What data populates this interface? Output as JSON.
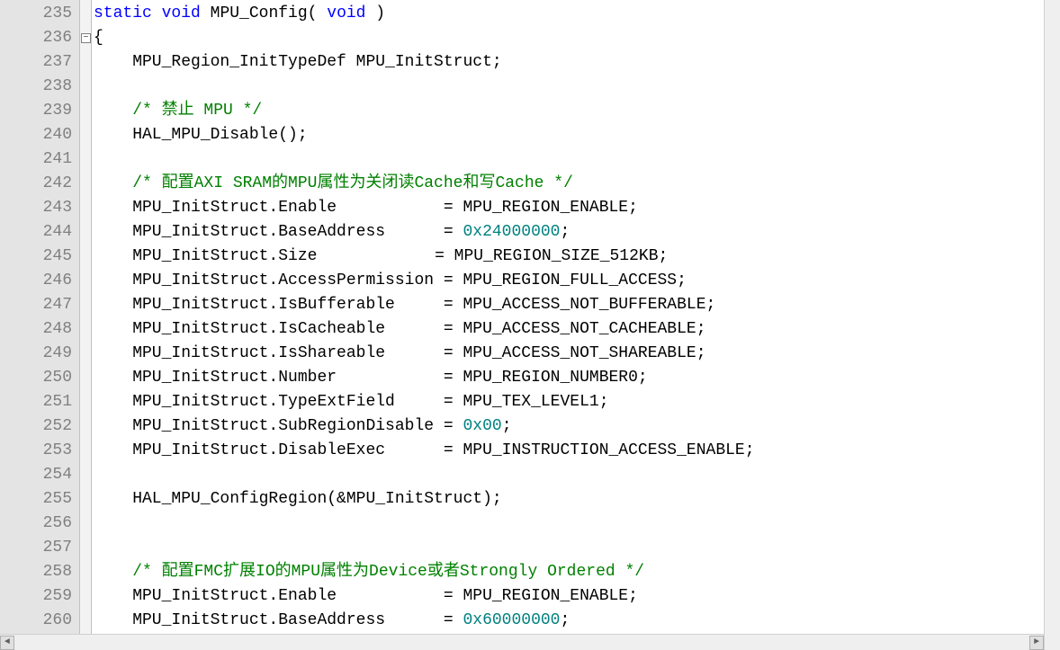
{
  "editor": {
    "fold_marker_glyph": "−",
    "lines": [
      {
        "num": "235",
        "segs": [
          {
            "cls": "kw",
            "t": "static"
          },
          {
            "t": " "
          },
          {
            "cls": "kw",
            "t": "void"
          },
          {
            "t": " MPU_Config( "
          },
          {
            "cls": "kw",
            "t": "void"
          },
          {
            "t": " )"
          }
        ]
      },
      {
        "num": "236",
        "fold": true,
        "segs": [
          {
            "t": "{"
          }
        ]
      },
      {
        "num": "237",
        "segs": [
          {
            "t": "    MPU_Region_InitTypeDef MPU_InitStruct;"
          }
        ]
      },
      {
        "num": "238",
        "segs": [
          {
            "t": ""
          }
        ]
      },
      {
        "num": "239",
        "segs": [
          {
            "t": "    "
          },
          {
            "cls": "cmt",
            "t": "/* 禁止 MPU */"
          }
        ]
      },
      {
        "num": "240",
        "segs": [
          {
            "t": "    HAL_MPU_Disable();"
          }
        ]
      },
      {
        "num": "241",
        "segs": [
          {
            "t": ""
          }
        ]
      },
      {
        "num": "242",
        "segs": [
          {
            "t": "    "
          },
          {
            "cls": "cmt",
            "t": "/* 配置AXI SRAM的MPU属性为关闭读Cache和写Cache */"
          }
        ]
      },
      {
        "num": "243",
        "segs": [
          {
            "t": "    MPU_InitStruct.Enable           = MPU_REGION_ENABLE;"
          }
        ]
      },
      {
        "num": "244",
        "segs": [
          {
            "t": "    MPU_InitStruct.BaseAddress      = "
          },
          {
            "cls": "num",
            "t": "0x24000000"
          },
          {
            "t": ";"
          }
        ]
      },
      {
        "num": "245",
        "segs": [
          {
            "t": "    MPU_InitStruct.Size"
          },
          {
            "caret": true
          },
          {
            "t": "            = MPU_REGION_SIZE_512KB;"
          }
        ]
      },
      {
        "num": "246",
        "segs": [
          {
            "t": "    MPU_InitStruct.AccessPermission = MPU_REGION_FULL_ACCESS;"
          }
        ]
      },
      {
        "num": "247",
        "segs": [
          {
            "t": "    MPU_InitStruct.IsBufferable     = MPU_ACCESS_NOT_BUFFERABLE;"
          }
        ]
      },
      {
        "num": "248",
        "segs": [
          {
            "t": "    MPU_InitStruct.IsCacheable      = MPU_ACCESS_NOT_CACHEABLE;"
          }
        ]
      },
      {
        "num": "249",
        "segs": [
          {
            "t": "    MPU_InitStruct.IsShareable      = MPU_ACCESS_NOT_SHAREABLE;"
          }
        ]
      },
      {
        "num": "250",
        "segs": [
          {
            "t": "    MPU_InitStruct.Number           = MPU_REGION_NUMBER0;"
          }
        ]
      },
      {
        "num": "251",
        "segs": [
          {
            "t": "    MPU_InitStruct.TypeExtField     = MPU_TEX_LEVEL1;"
          }
        ]
      },
      {
        "num": "252",
        "segs": [
          {
            "t": "    MPU_InitStruct.SubRegionDisable = "
          },
          {
            "cls": "num",
            "t": "0x00"
          },
          {
            "t": ";"
          }
        ]
      },
      {
        "num": "253",
        "segs": [
          {
            "t": "    MPU_InitStruct.DisableExec      = MPU_INSTRUCTION_ACCESS_ENABLE;"
          }
        ]
      },
      {
        "num": "254",
        "segs": [
          {
            "t": ""
          }
        ]
      },
      {
        "num": "255",
        "segs": [
          {
            "t": "    HAL_MPU_ConfigRegion(&MPU_InitStruct);"
          }
        ]
      },
      {
        "num": "256",
        "segs": [
          {
            "t": "    "
          }
        ]
      },
      {
        "num": "257",
        "segs": [
          {
            "t": "    "
          }
        ]
      },
      {
        "num": "258",
        "segs": [
          {
            "t": "    "
          },
          {
            "cls": "cmt",
            "t": "/* 配置FMC扩展IO的MPU属性为Device或者Strongly Ordered */"
          }
        ]
      },
      {
        "num": "259",
        "segs": [
          {
            "t": "    MPU_InitStruct.Enable           = MPU_REGION_ENABLE;"
          }
        ]
      },
      {
        "num": "260",
        "segs": [
          {
            "t": "    MPU_InitStruct.BaseAddress      = "
          },
          {
            "cls": "num",
            "t": "0x60000000"
          },
          {
            "t": ";"
          }
        ]
      }
    ]
  },
  "scrollbar": {
    "left_arrow": "◄",
    "right_arrow": "►"
  }
}
